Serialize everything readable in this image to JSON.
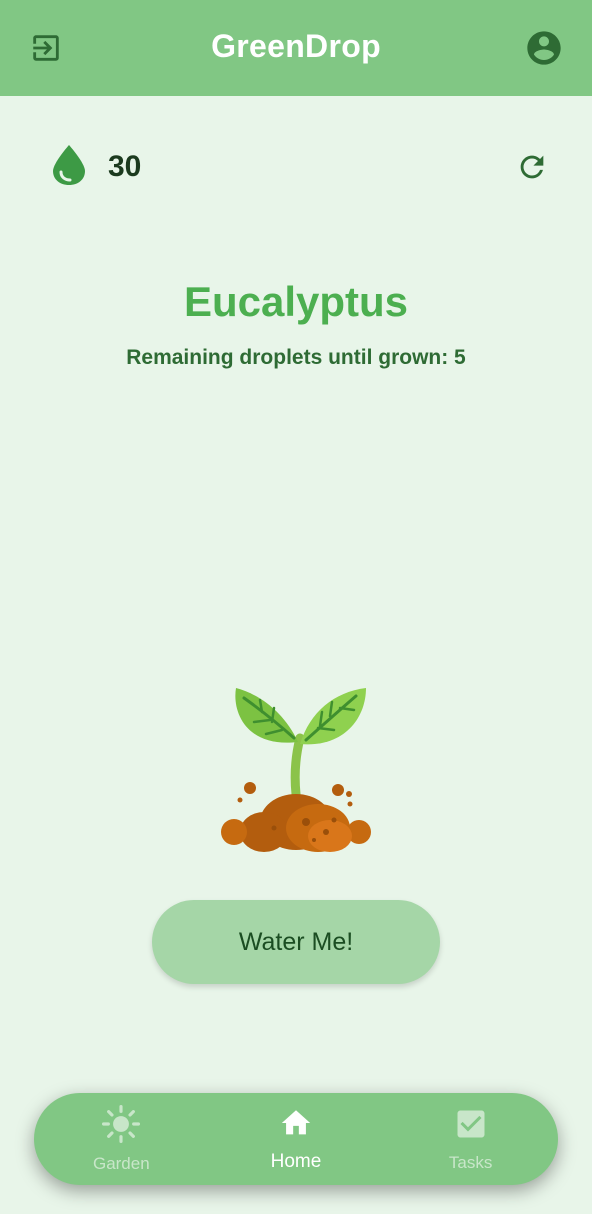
{
  "app": {
    "title": "GreenDrop"
  },
  "header": {
    "left_icon": "exit-icon",
    "right_icon": "account-circle-icon"
  },
  "stats": {
    "droplet_icon": "water-drop-icon",
    "droplets": "30",
    "refresh_icon": "refresh-icon"
  },
  "plant": {
    "name": "Eucalyptus",
    "remaining_text": "Remaining droplets until grown: 5",
    "image_icon": "sprout-illustration"
  },
  "actions": {
    "water_label": "Water Me!"
  },
  "bottom_nav": {
    "items": [
      {
        "label": "Garden",
        "icon": "sun-icon",
        "active": false
      },
      {
        "label": "Home",
        "icon": "home-icon",
        "active": true
      },
      {
        "label": "Tasks",
        "icon": "check-box-icon",
        "active": false
      }
    ]
  },
  "colors": {
    "appbar": "#81c784",
    "background": "#e8f5e9",
    "accent": "#4caf50",
    "button": "#a5d6a7",
    "droplet": "#3d9a45"
  }
}
